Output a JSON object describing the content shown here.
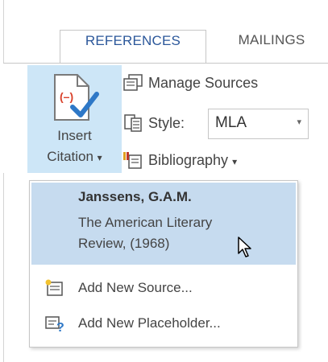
{
  "tabs": [
    {
      "label": "REFERENCES",
      "active": true
    },
    {
      "label": "MAILINGS",
      "active": false
    }
  ],
  "ribbon": {
    "insert_citation": {
      "line1": "Insert",
      "line2": "Citation",
      "dropdown_arrow": "▾",
      "icon": "insert-citation-icon"
    },
    "manage_sources": {
      "label": "Manage Sources",
      "icon": "manage-sources-icon"
    },
    "style": {
      "label": "Style:",
      "value": "MLA",
      "arrow": "▾",
      "icon": "style-icon"
    },
    "bibliography": {
      "label": "Bibliography",
      "arrow": "▾",
      "icon": "bibliography-icon"
    }
  },
  "dropdown": {
    "citation": {
      "author": "Janssens, G.A.M.",
      "title_line1": "The American Literary",
      "title_line2": "Review, (1968)"
    },
    "add_new_source": {
      "label": "Add New Source...",
      "icon": "add-source-icon"
    },
    "add_new_placeholder": {
      "label": "Add New Placeholder...",
      "icon": "placeholder-icon"
    }
  },
  "colors": {
    "accent_text": "#2b579a",
    "button_highlight": "#cde6f7",
    "entry_highlight": "#c6dbef"
  }
}
